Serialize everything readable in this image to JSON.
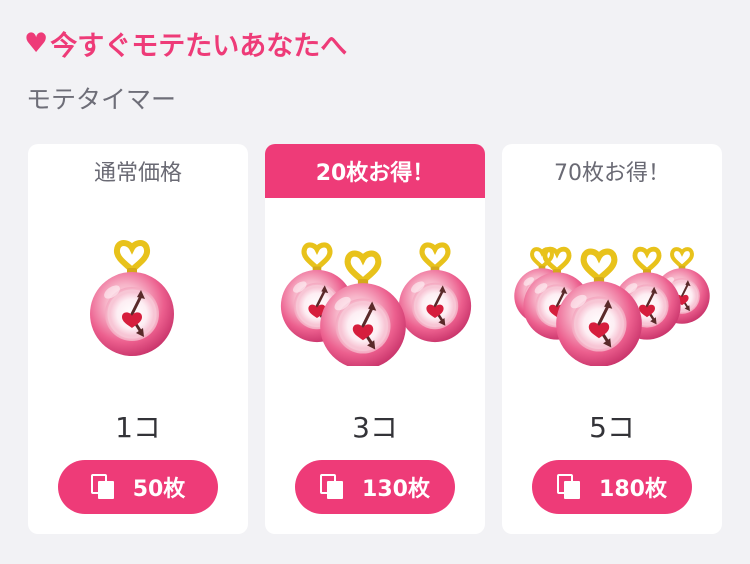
{
  "header": {
    "title": "今すぐモテたいあなたへ",
    "heart_icon": "heart-icon",
    "subtitle": "モテタイマー"
  },
  "colors": {
    "accent": "#ee3b78",
    "background": "#f2f2f5",
    "card": "#ffffff"
  },
  "cards": [
    {
      "label": "通常価格",
      "highlighted": false,
      "quantity": "1コ",
      "price": "50枚",
      "icon": "ticket-icon"
    },
    {
      "label": "20枚お得！",
      "highlighted": true,
      "quantity": "3コ",
      "price": "130枚",
      "icon": "ticket-icon"
    },
    {
      "label": "70枚お得！",
      "highlighted": false,
      "quantity": "5コ",
      "price": "180枚",
      "icon": "ticket-icon"
    }
  ]
}
